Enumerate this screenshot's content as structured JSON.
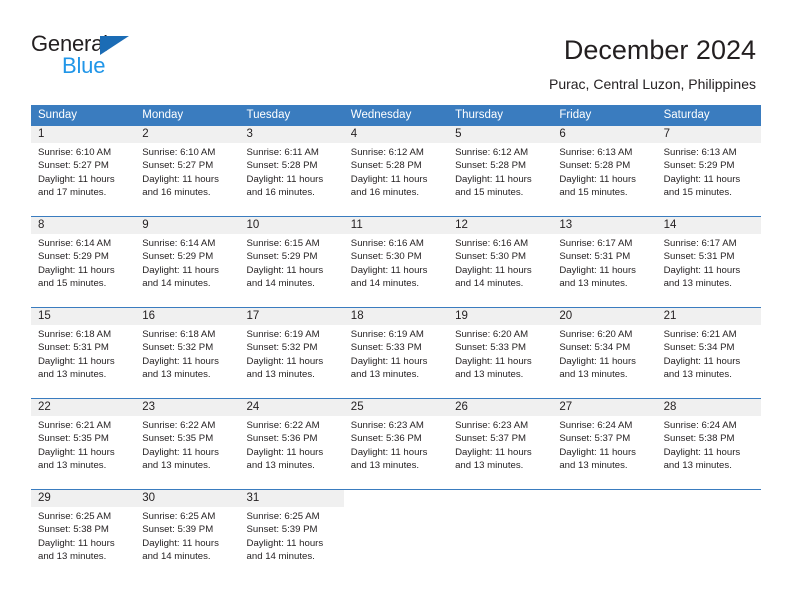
{
  "brand": {
    "name_part1": "General",
    "name_part2": "Blue",
    "triangle_color": "#1b6cb5",
    "blue_color": "#2196e8"
  },
  "header": {
    "title": "December 2024",
    "subtitle": "Purac, Central Luzon, Philippines"
  },
  "theme": {
    "header_bg": "#3a7cbf",
    "day_band_bg": "#f0f0f0",
    "text": "#231f20"
  },
  "calendar": {
    "weekday_headers": [
      "Sunday",
      "Monday",
      "Tuesday",
      "Wednesday",
      "Thursday",
      "Friday",
      "Saturday"
    ],
    "weeks": [
      [
        {
          "day": "1",
          "sunrise": "Sunrise: 6:10 AM",
          "sunset": "Sunset: 5:27 PM",
          "daylight": "Daylight: 11 hours and 17 minutes."
        },
        {
          "day": "2",
          "sunrise": "Sunrise: 6:10 AM",
          "sunset": "Sunset: 5:27 PM",
          "daylight": "Daylight: 11 hours and 16 minutes."
        },
        {
          "day": "3",
          "sunrise": "Sunrise: 6:11 AM",
          "sunset": "Sunset: 5:28 PM",
          "daylight": "Daylight: 11 hours and 16 minutes."
        },
        {
          "day": "4",
          "sunrise": "Sunrise: 6:12 AM",
          "sunset": "Sunset: 5:28 PM",
          "daylight": "Daylight: 11 hours and 16 minutes."
        },
        {
          "day": "5",
          "sunrise": "Sunrise: 6:12 AM",
          "sunset": "Sunset: 5:28 PM",
          "daylight": "Daylight: 11 hours and 15 minutes."
        },
        {
          "day": "6",
          "sunrise": "Sunrise: 6:13 AM",
          "sunset": "Sunset: 5:28 PM",
          "daylight": "Daylight: 11 hours and 15 minutes."
        },
        {
          "day": "7",
          "sunrise": "Sunrise: 6:13 AM",
          "sunset": "Sunset: 5:29 PM",
          "daylight": "Daylight: 11 hours and 15 minutes."
        }
      ],
      [
        {
          "day": "8",
          "sunrise": "Sunrise: 6:14 AM",
          "sunset": "Sunset: 5:29 PM",
          "daylight": "Daylight: 11 hours and 15 minutes."
        },
        {
          "day": "9",
          "sunrise": "Sunrise: 6:14 AM",
          "sunset": "Sunset: 5:29 PM",
          "daylight": "Daylight: 11 hours and 14 minutes."
        },
        {
          "day": "10",
          "sunrise": "Sunrise: 6:15 AM",
          "sunset": "Sunset: 5:29 PM",
          "daylight": "Daylight: 11 hours and 14 minutes."
        },
        {
          "day": "11",
          "sunrise": "Sunrise: 6:16 AM",
          "sunset": "Sunset: 5:30 PM",
          "daylight": "Daylight: 11 hours and 14 minutes."
        },
        {
          "day": "12",
          "sunrise": "Sunrise: 6:16 AM",
          "sunset": "Sunset: 5:30 PM",
          "daylight": "Daylight: 11 hours and 14 minutes."
        },
        {
          "day": "13",
          "sunrise": "Sunrise: 6:17 AM",
          "sunset": "Sunset: 5:31 PM",
          "daylight": "Daylight: 11 hours and 13 minutes."
        },
        {
          "day": "14",
          "sunrise": "Sunrise: 6:17 AM",
          "sunset": "Sunset: 5:31 PM",
          "daylight": "Daylight: 11 hours and 13 minutes."
        }
      ],
      [
        {
          "day": "15",
          "sunrise": "Sunrise: 6:18 AM",
          "sunset": "Sunset: 5:31 PM",
          "daylight": "Daylight: 11 hours and 13 minutes."
        },
        {
          "day": "16",
          "sunrise": "Sunrise: 6:18 AM",
          "sunset": "Sunset: 5:32 PM",
          "daylight": "Daylight: 11 hours and 13 minutes."
        },
        {
          "day": "17",
          "sunrise": "Sunrise: 6:19 AM",
          "sunset": "Sunset: 5:32 PM",
          "daylight": "Daylight: 11 hours and 13 minutes."
        },
        {
          "day": "18",
          "sunrise": "Sunrise: 6:19 AM",
          "sunset": "Sunset: 5:33 PM",
          "daylight": "Daylight: 11 hours and 13 minutes."
        },
        {
          "day": "19",
          "sunrise": "Sunrise: 6:20 AM",
          "sunset": "Sunset: 5:33 PM",
          "daylight": "Daylight: 11 hours and 13 minutes."
        },
        {
          "day": "20",
          "sunrise": "Sunrise: 6:20 AM",
          "sunset": "Sunset: 5:34 PM",
          "daylight": "Daylight: 11 hours and 13 minutes."
        },
        {
          "day": "21",
          "sunrise": "Sunrise: 6:21 AM",
          "sunset": "Sunset: 5:34 PM",
          "daylight": "Daylight: 11 hours and 13 minutes."
        }
      ],
      [
        {
          "day": "22",
          "sunrise": "Sunrise: 6:21 AM",
          "sunset": "Sunset: 5:35 PM",
          "daylight": "Daylight: 11 hours and 13 minutes."
        },
        {
          "day": "23",
          "sunrise": "Sunrise: 6:22 AM",
          "sunset": "Sunset: 5:35 PM",
          "daylight": "Daylight: 11 hours and 13 minutes."
        },
        {
          "day": "24",
          "sunrise": "Sunrise: 6:22 AM",
          "sunset": "Sunset: 5:36 PM",
          "daylight": "Daylight: 11 hours and 13 minutes."
        },
        {
          "day": "25",
          "sunrise": "Sunrise: 6:23 AM",
          "sunset": "Sunset: 5:36 PM",
          "daylight": "Daylight: 11 hours and 13 minutes."
        },
        {
          "day": "26",
          "sunrise": "Sunrise: 6:23 AM",
          "sunset": "Sunset: 5:37 PM",
          "daylight": "Daylight: 11 hours and 13 minutes."
        },
        {
          "day": "27",
          "sunrise": "Sunrise: 6:24 AM",
          "sunset": "Sunset: 5:37 PM",
          "daylight": "Daylight: 11 hours and 13 minutes."
        },
        {
          "day": "28",
          "sunrise": "Sunrise: 6:24 AM",
          "sunset": "Sunset: 5:38 PM",
          "daylight": "Daylight: 11 hours and 13 minutes."
        }
      ],
      [
        {
          "day": "29",
          "sunrise": "Sunrise: 6:25 AM",
          "sunset": "Sunset: 5:38 PM",
          "daylight": "Daylight: 11 hours and 13 minutes."
        },
        {
          "day": "30",
          "sunrise": "Sunrise: 6:25 AM",
          "sunset": "Sunset: 5:39 PM",
          "daylight": "Daylight: 11 hours and 14 minutes."
        },
        {
          "day": "31",
          "sunrise": "Sunrise: 6:25 AM",
          "sunset": "Sunset: 5:39 PM",
          "daylight": "Daylight: 11 hours and 14 minutes."
        },
        {
          "day": "",
          "sunrise": "",
          "sunset": "",
          "daylight": ""
        },
        {
          "day": "",
          "sunrise": "",
          "sunset": "",
          "daylight": ""
        },
        {
          "day": "",
          "sunrise": "",
          "sunset": "",
          "daylight": ""
        },
        {
          "day": "",
          "sunrise": "",
          "sunset": "",
          "daylight": ""
        }
      ]
    ]
  }
}
